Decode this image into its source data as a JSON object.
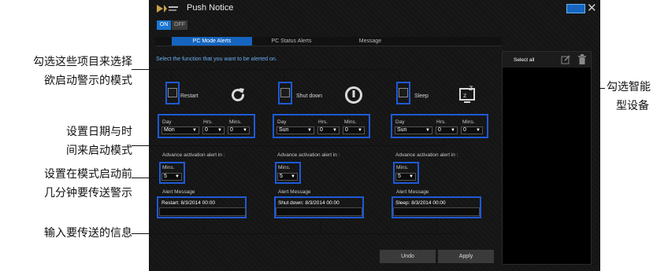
{
  "app": {
    "title": "Push Notice",
    "on_label": "ON",
    "off_label": "OFF",
    "tabs": [
      "PC Mode Alerts",
      "PC Status Alerts",
      "Message"
    ],
    "instruction": "Select the function that you want to be alerted on.",
    "select_all": "Select all",
    "undo_label": "Undo",
    "apply_label": "Apply",
    "day_label": "Day",
    "hrs_label": "Hrs.",
    "mins_label": "Mins.",
    "advance_label": "Advance activation alert in :",
    "alert_message_label": "Alert Message",
    "modes": [
      {
        "name": "Restart",
        "day": "Mon",
        "hrs": "0",
        "mins": "0",
        "advance_mins": "5",
        "message": "Restart: 8/3/2014 00:00",
        "icon": "restart-icon"
      },
      {
        "name": "Shut down",
        "day": "Sun",
        "hrs": "0",
        "mins": "0",
        "advance_mins": "5",
        "message": "Shut down: 8/3/2014 00:00",
        "icon": "power-icon"
      },
      {
        "name": "Sleep",
        "day": "Sun",
        "hrs": "0",
        "mins": "0",
        "advance_mins": "5",
        "message": "Sleep: 8/3/2014 00:00",
        "icon": "sleep-icon"
      }
    ]
  },
  "annotations": {
    "left": [
      "勾选这些项目来选择",
      "欲启动警示的模式",
      "设置日期与时",
      "间来启动模式",
      "设置在模式启动前",
      "几分钟要传送警示",
      "输入要传送的信息"
    ],
    "right": [
      "勾选智能",
      "型设备"
    ]
  },
  "colors": {
    "highlight": "#1e5ad6",
    "accent": "#1565c0",
    "background": "#151515"
  }
}
